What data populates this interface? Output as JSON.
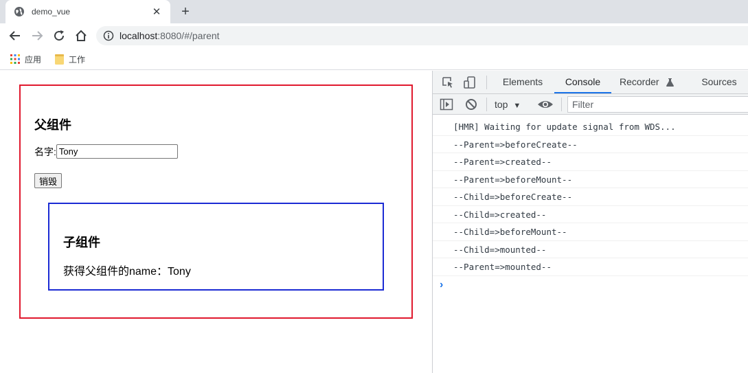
{
  "browser": {
    "tab_title": "demo_vue",
    "url_host": "localhost",
    "url_path": ":8080/#/parent",
    "bookmarks": [
      {
        "label": "应用",
        "icon": "apps-grid-icon"
      },
      {
        "label": "工作",
        "icon": "folder-icon"
      }
    ]
  },
  "page": {
    "parent_title": "父组件",
    "name_label": "名字:",
    "name_value": "Tony",
    "destroy_button": "销毁",
    "child_title": "子组件",
    "child_text": "获得父组件的name：Tony",
    "colors": {
      "parent_border": "#e0182d",
      "child_border": "#1b2bd4"
    }
  },
  "devtools": {
    "tabs": [
      "Elements",
      "Console",
      "Recorder",
      "Sources"
    ],
    "active_tab": "Console",
    "context": "top",
    "filter_placeholder": "Filter",
    "logs": [
      "[HMR] Waiting for update signal from WDS...",
      "--Parent=>beforeCreate--",
      "--Parent=>created--",
      "--Parent=>beforeMount--",
      "--Child=>beforeCreate--",
      "--Child=>created--",
      "--Child=>beforeMount--",
      "--Child=>mounted--",
      "--Parent=>mounted--"
    ],
    "prompt": "›"
  }
}
